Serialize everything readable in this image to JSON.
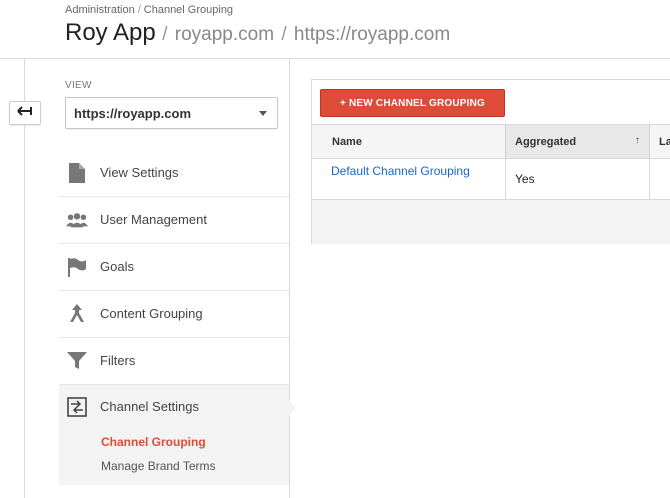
{
  "breadcrumb": {
    "items": [
      "Administration",
      "Channel Grouping"
    ],
    "separator": "/"
  },
  "header": {
    "app_name": "Roy App",
    "separator": "/",
    "property": "royapp.com",
    "view": "https://royapp.com"
  },
  "view_selector": {
    "label": "VIEW",
    "selected": "https://royapp.com"
  },
  "nav": {
    "items": [
      {
        "label": "View Settings",
        "icon": "document-icon"
      },
      {
        "label": "User Management",
        "icon": "users-icon"
      },
      {
        "label": "Goals",
        "icon": "flag-icon"
      },
      {
        "label": "Content Grouping",
        "icon": "content-grouping-icon"
      },
      {
        "label": "Filters",
        "icon": "filter-icon"
      }
    ],
    "active": {
      "label": "Channel Settings",
      "icon": "channel-settings-icon",
      "sub_items": [
        "Channel Grouping",
        "Manage Brand Terms"
      ]
    }
  },
  "toolbar": {
    "new_button_label": "+ NEW CHANNEL GROUPING"
  },
  "table": {
    "columns": [
      "Name",
      "Aggregated",
      "La"
    ],
    "sort_indicator": "↑",
    "rows": [
      {
        "name": "Default Channel Grouping",
        "aggregated": "Yes"
      }
    ]
  },
  "colors": {
    "accent_red": "#dd4b39",
    "link_blue": "#1a66c8"
  }
}
